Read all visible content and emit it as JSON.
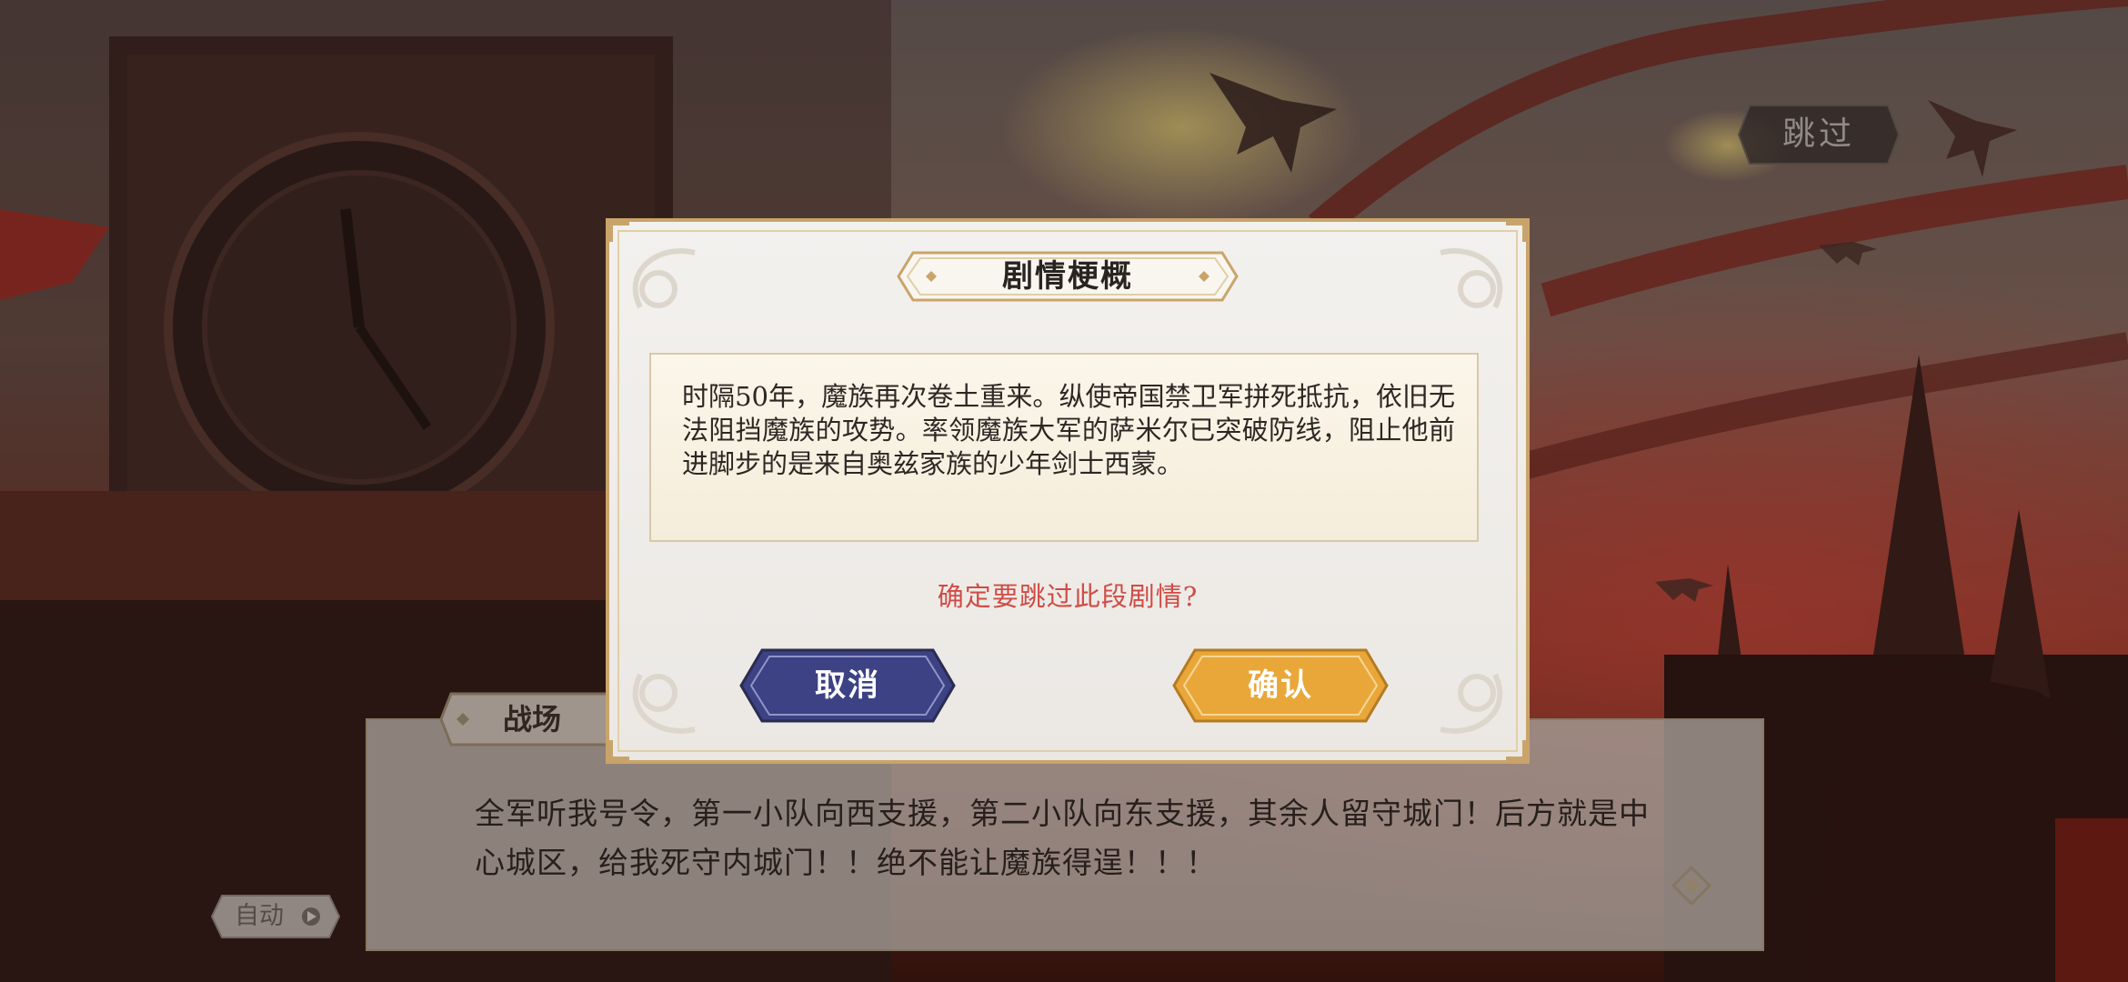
{
  "skip": {
    "label": "跳过"
  },
  "dialogue": {
    "speaker": "战场",
    "text": "全军听我号令，第一小队向西支援，第二小队向东支援，其余人留守城门！后方就是中心城区，给我死守内城门！！绝不能让魔族得逞！！！"
  },
  "auto": {
    "label": "自动"
  },
  "modal": {
    "title": "剧情梗概",
    "summary": "时隔50年，魔族再次卷土重来。纵使帝国禁卫军拼死抵抗，依旧无法阻挡魔族的攻势。率领魔族大军的萨米尔已突破防线，阻止他前进脚步的是来自奥兹家族的少年剑士西蒙。",
    "question": "确定要跳过此段剧情?",
    "cancel_label": "取消",
    "confirm_label": "确认"
  },
  "colors": {
    "cancel": "#3c4284",
    "confirm": "#e9a73a",
    "question": "#d04c45",
    "frame_gold": "#c9a46a"
  }
}
